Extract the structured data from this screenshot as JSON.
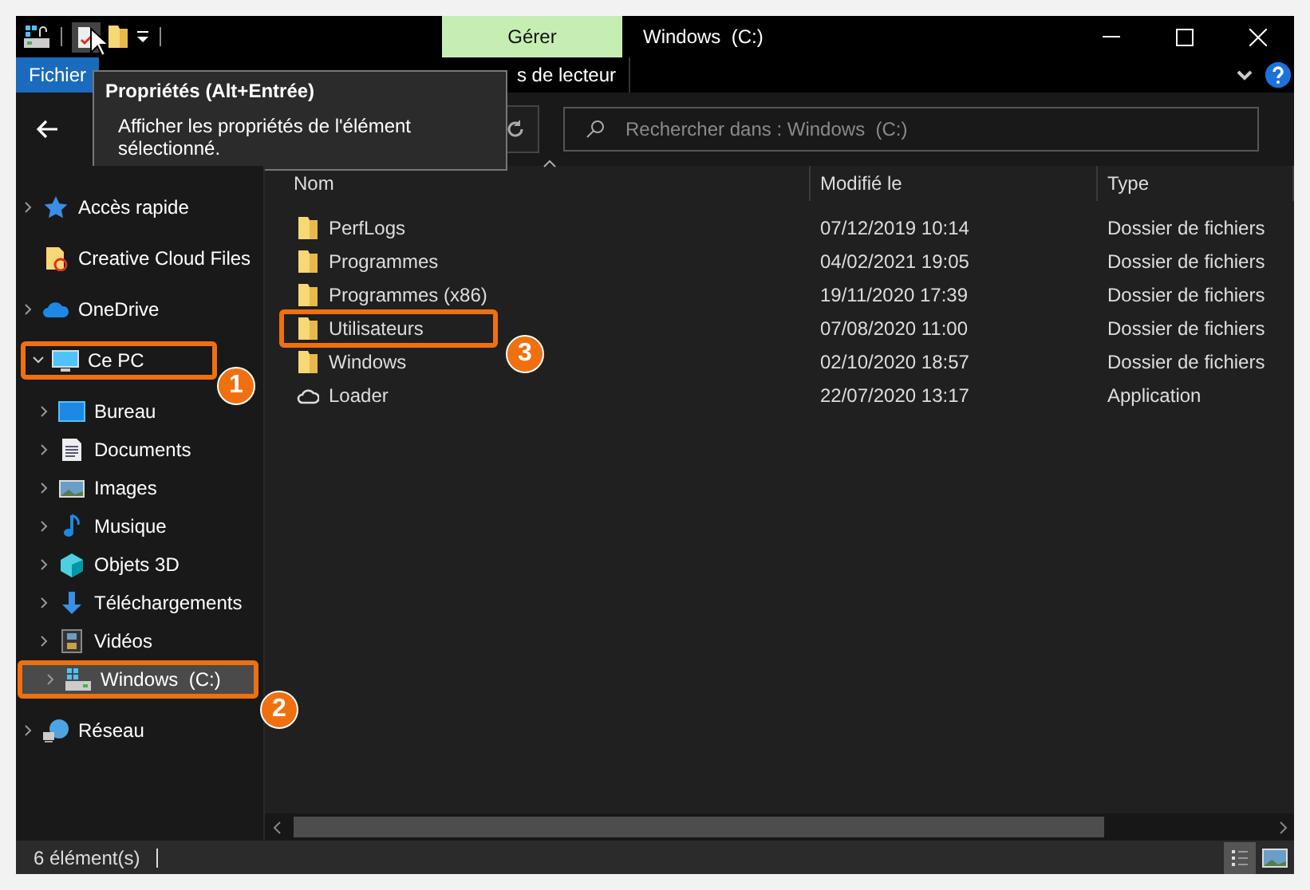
{
  "window": {
    "title": "Windows  (C:)",
    "context_tab": "Gérer"
  },
  "ribbon": {
    "tabs": [
      {
        "label": "Fichier",
        "selected": true
      },
      {
        "label": "s de lecteur",
        "selected": false
      }
    ]
  },
  "tooltip": {
    "title": "Propriétés (Alt+Entrée)",
    "text": "Afficher les propriétés de l'élément sélectionné."
  },
  "search": {
    "placeholder": "Rechercher dans : Windows  (C:)"
  },
  "sidebar": {
    "items": [
      {
        "label": "Accès rapide",
        "kind": "star",
        "expanded": false,
        "selected": false
      },
      {
        "label": "Creative Cloud Files",
        "kind": "cloud-folder",
        "selected": false
      },
      {
        "label": "OneDrive",
        "kind": "cloud",
        "expanded": false,
        "selected": false
      },
      {
        "label": "Ce PC",
        "kind": "pc",
        "expanded": true,
        "selected": false,
        "callout": "1",
        "children": [
          {
            "label": "Bureau",
            "kind": "desktop",
            "expanded": false,
            "selected": false
          },
          {
            "label": "Documents",
            "kind": "documents",
            "expanded": false,
            "selected": false
          },
          {
            "label": "Images",
            "kind": "images",
            "expanded": false,
            "selected": false
          },
          {
            "label": "Musique",
            "kind": "music",
            "expanded": false,
            "selected": false
          },
          {
            "label": "Objets 3D",
            "kind": "cube",
            "expanded": false,
            "selected": false
          },
          {
            "label": "Téléchargements",
            "kind": "download",
            "expanded": false,
            "selected": false
          },
          {
            "label": "Vidéos",
            "kind": "videos",
            "expanded": false,
            "selected": false
          },
          {
            "label": "Windows  (C:)",
            "kind": "drive",
            "expanded": false,
            "selected": true,
            "callout": "2"
          }
        ]
      },
      {
        "label": "Réseau",
        "kind": "network",
        "expanded": false,
        "selected": false
      }
    ]
  },
  "table": {
    "columns": [
      "Nom",
      "Modifié le",
      "Type"
    ],
    "rows": [
      {
        "name": "PerfLogs",
        "kind": "folder",
        "modified": "07/12/2019 10:14",
        "type": "Dossier de fichiers"
      },
      {
        "name": "Programmes",
        "kind": "folder",
        "modified": "04/02/2021 19:05",
        "type": "Dossier de fichiers"
      },
      {
        "name": "Programmes (x86)",
        "kind": "folder",
        "modified": "19/11/2020 17:39",
        "type": "Dossier de fichiers"
      },
      {
        "name": "Utilisateurs",
        "kind": "folder",
        "modified": "07/08/2020 11:00",
        "type": "Dossier de fichiers",
        "callout": "3"
      },
      {
        "name": "Windows",
        "kind": "folder",
        "modified": "02/10/2020 18:57",
        "type": "Dossier de fichiers"
      },
      {
        "name": "Loader",
        "kind": "app",
        "modified": "22/07/2020 13:17",
        "type": "Application"
      }
    ]
  },
  "status_bar": {
    "count": "6 élément(s)"
  }
}
